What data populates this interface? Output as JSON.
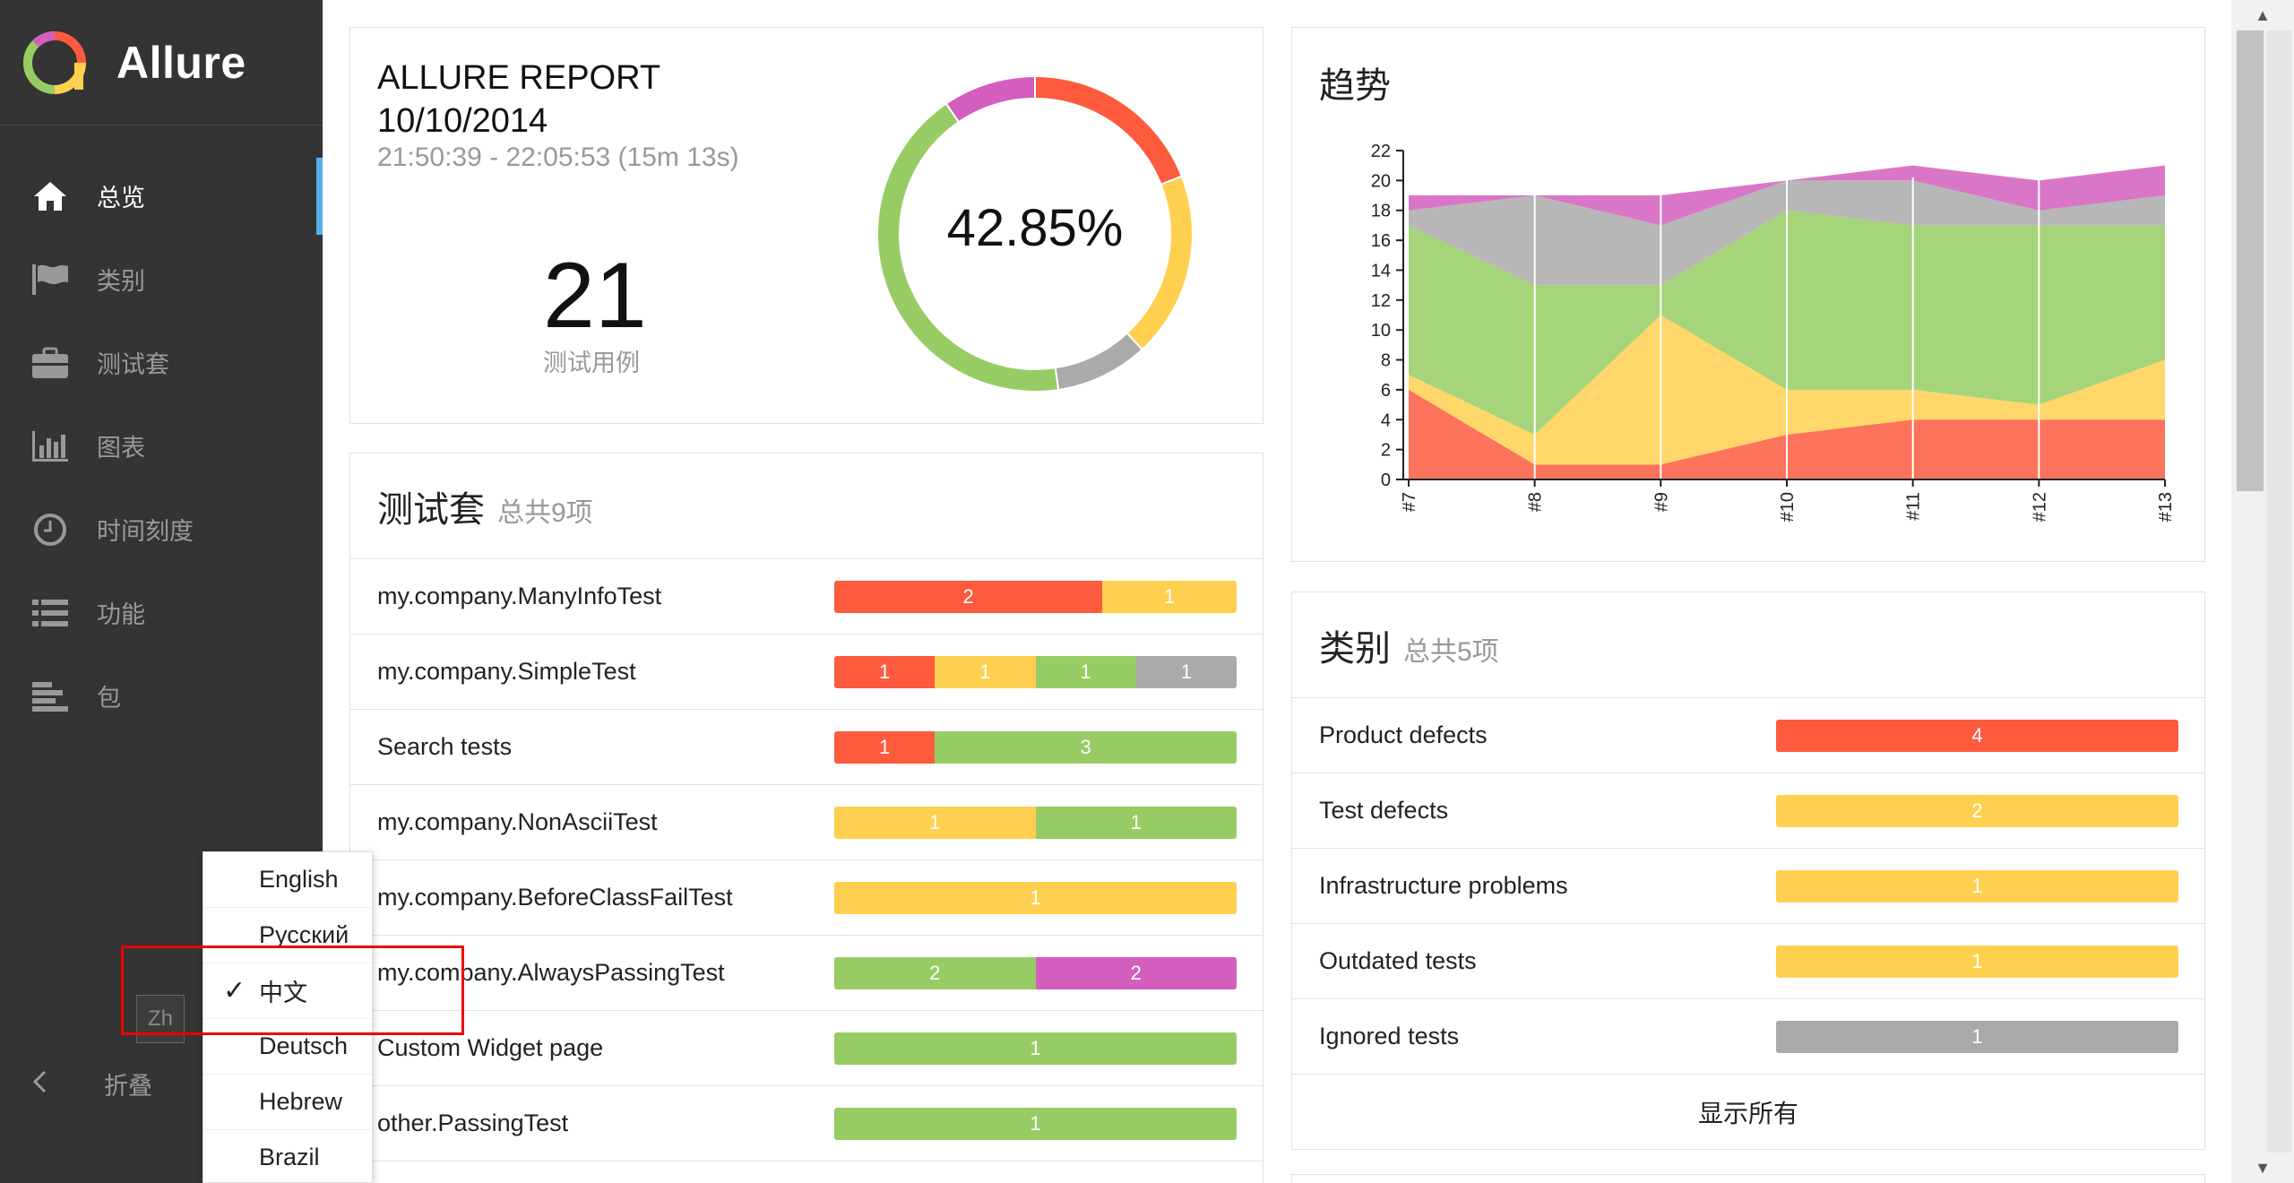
{
  "app": {
    "title": "Allure"
  },
  "sidebar": {
    "items": [
      {
        "label": "总览",
        "icon": "home-icon",
        "active": true
      },
      {
        "label": "类别",
        "icon": "flag-icon",
        "active": false
      },
      {
        "label": "测试套",
        "icon": "briefcase-icon",
        "active": false
      },
      {
        "label": "图表",
        "icon": "bar-chart-icon",
        "active": false
      },
      {
        "label": "时间刻度",
        "icon": "clock-icon",
        "active": false
      },
      {
        "label": "功能",
        "icon": "list-icon",
        "active": false
      },
      {
        "label": "包",
        "icon": "align-left-icon",
        "active": false
      }
    ],
    "collapse_label": "折叠",
    "lang_button": "Zh"
  },
  "language_menu": {
    "items": [
      "English",
      "Русский",
      "中文",
      "Deutsch",
      "Hebrew",
      "Brazil"
    ],
    "selected": "中文",
    "check_mark": "✓"
  },
  "summary": {
    "title_line1": "ALLURE REPORT",
    "title_line2": "10/10/2014",
    "time": "21:50:39 - 22:05:53 (15m 13s)",
    "testcases_count": "21",
    "testcases_label": "测试用例",
    "success_rate": "42.85%",
    "donut": [
      {
        "status": "failed",
        "value": 4,
        "color": "#fd5a3e"
      },
      {
        "status": "broken",
        "value": 4,
        "color": "#ffd050"
      },
      {
        "status": "skipped",
        "value": 2,
        "color": "#aaaaaa"
      },
      {
        "status": "passed",
        "value": 9,
        "color": "#97cc64"
      },
      {
        "status": "unknown",
        "value": 2,
        "color": "#d35ebe"
      }
    ]
  },
  "trend": {
    "title": "趋势"
  },
  "suites": {
    "title": "测试套",
    "count_label": "总共9项",
    "rows": [
      {
        "name": "my.company.ManyInfoTest",
        "segments": [
          {
            "status": "failed",
            "value": 2
          },
          {
            "status": "broken",
            "value": 1
          }
        ]
      },
      {
        "name": "my.company.SimpleTest",
        "segments": [
          {
            "status": "failed",
            "value": 1
          },
          {
            "status": "broken",
            "value": 1
          },
          {
            "status": "passed",
            "value": 1
          },
          {
            "status": "skipped",
            "value": 1
          }
        ]
      },
      {
        "name": "Search tests",
        "segments": [
          {
            "status": "failed",
            "value": 1
          },
          {
            "status": "passed",
            "value": 3
          }
        ]
      },
      {
        "name": "my.company.NonAsciiTest",
        "segments": [
          {
            "status": "broken",
            "value": 1
          },
          {
            "status": "passed",
            "value": 1
          }
        ]
      },
      {
        "name": "my.company.BeforeClassFailTest",
        "segments": [
          {
            "status": "broken",
            "value": 1
          }
        ]
      },
      {
        "name": "my.company.AlwaysPassingTest",
        "segments": [
          {
            "status": "passed",
            "value": 2
          },
          {
            "status": "unknown",
            "value": 2
          }
        ]
      },
      {
        "name": "Custom Widget page",
        "segments": [
          {
            "status": "passed",
            "value": 1
          }
        ]
      },
      {
        "name": "other.PassingTest",
        "segments": [
          {
            "status": "passed",
            "value": 1
          }
        ]
      }
    ]
  },
  "categories": {
    "title": "类别",
    "count_label": "总共5项",
    "rows": [
      {
        "name": "Product defects",
        "segments": [
          {
            "status": "failed",
            "value": 4
          }
        ]
      },
      {
        "name": "Test defects",
        "segments": [
          {
            "status": "broken",
            "value": 2
          }
        ]
      },
      {
        "name": "Infrastructure problems",
        "segments": [
          {
            "status": "broken",
            "value": 1
          }
        ]
      },
      {
        "name": "Outdated tests",
        "segments": [
          {
            "status": "broken",
            "value": 1
          }
        ]
      },
      {
        "name": "Ignored tests",
        "segments": [
          {
            "status": "skipped",
            "value": 1
          }
        ]
      }
    ],
    "show_all": "显示所有"
  },
  "chart_data": {
    "type": "area",
    "x": [
      "#7",
      "#8",
      "#9",
      "#10",
      "#11",
      "#12",
      "#13"
    ],
    "ylim": [
      0,
      22
    ],
    "yticks": [
      0,
      2,
      4,
      6,
      8,
      10,
      12,
      14,
      16,
      18,
      20,
      22
    ],
    "series": [
      {
        "status": "failed",
        "color": "#fd5a3e",
        "values": [
          6,
          1,
          1,
          3,
          4,
          4,
          4
        ]
      },
      {
        "status": "broken",
        "color": "#ffd050",
        "values": [
          1,
          2,
          10,
          3,
          2,
          1,
          4
        ]
      },
      {
        "status": "passed",
        "color": "#97cc64",
        "values": [
          10,
          10,
          2,
          12,
          11,
          12,
          9
        ]
      },
      {
        "status": "skipped",
        "color": "#aaaaaa",
        "values": [
          1,
          6,
          4,
          2,
          3,
          1,
          2
        ]
      },
      {
        "status": "unknown",
        "color": "#d35ebe",
        "values": [
          1,
          0,
          2,
          0,
          1,
          2,
          2
        ]
      }
    ]
  }
}
